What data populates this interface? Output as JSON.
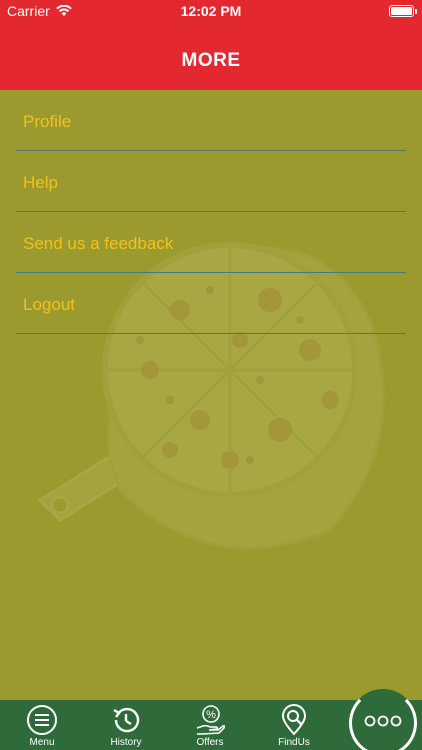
{
  "status_bar": {
    "carrier": "Carrier",
    "time": "12:02 PM"
  },
  "header": {
    "title": "MORE"
  },
  "menu_items": [
    {
      "label": "Profile"
    },
    {
      "label": "Help"
    },
    {
      "label": "Send us a feedback"
    },
    {
      "label": "Logout"
    }
  ],
  "tabs": [
    {
      "label": "Menu",
      "icon": "menu-list-icon"
    },
    {
      "label": "History",
      "icon": "history-clock-icon"
    },
    {
      "label": "Offers",
      "icon": "percent-offer-icon"
    },
    {
      "label": "FindUs",
      "icon": "map-search-icon"
    },
    {
      "label": "",
      "icon": "more-dots-icon"
    }
  ],
  "colors": {
    "header": "#e3282f",
    "background": "#9a9a2e",
    "menu_text": "#f1c21c",
    "divider": "#4a7a76",
    "tabbar": "#2f6b3a"
  }
}
